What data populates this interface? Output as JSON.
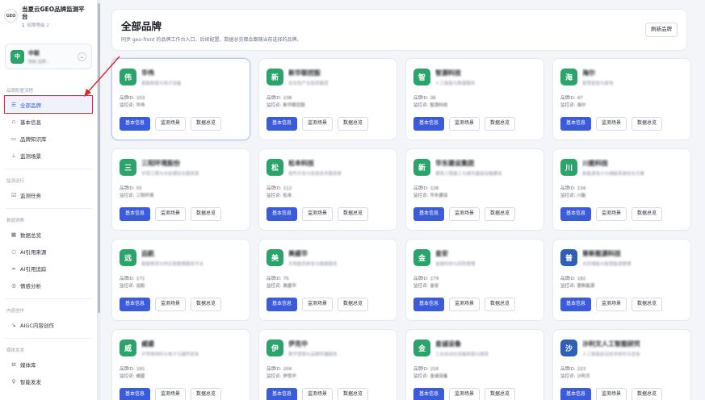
{
  "app": {
    "logo_text": "GEO",
    "title": "当夏云GEO品牌监测平台",
    "sub_num": "1",
    "sub_text": "权限等级 2"
  },
  "current_brand": {
    "logo_char": "中",
    "name": "中联",
    "desc": "智能 品牌..."
  },
  "sidebar": {
    "sections": [
      {
        "title": "品牌配置流程",
        "items": [
          {
            "icon": "☰",
            "label": "全部品牌"
          },
          {
            "icon": "▫",
            "label": "基本信息"
          },
          {
            "icon": "▭",
            "label": "品牌知识库"
          },
          {
            "icon": "⊥",
            "label": "监测场景"
          }
        ]
      },
      {
        "title": "监测运行",
        "items": [
          {
            "icon": "☑",
            "label": "监测任务"
          }
        ]
      },
      {
        "title": "数据洞察",
        "items": [
          {
            "icon": "▦",
            "label": "数据总览"
          },
          {
            "icon": "○",
            "label": "AI引用来源"
          },
          {
            "icon": "∞",
            "label": "AI引用追踪"
          },
          {
            "icon": "◎",
            "label": "情感分析"
          }
        ]
      },
      {
        "title": "内容创作",
        "items": [
          {
            "icon": "↘",
            "label": "AIGC内容创作"
          }
        ]
      },
      {
        "title": "媒体发发",
        "items": [
          {
            "icon": "⊟",
            "label": "媒体库"
          },
          {
            "icon": "♀",
            "label": "智能发发"
          }
        ]
      }
    ]
  },
  "header": {
    "title": "全部品牌",
    "desc": "同步 geo-front 的品牌工作台入口，后续配置、数据总览都会跟随当前选择的品牌。",
    "refresh_label": "刷新品牌"
  },
  "labels": {
    "brand_id": "品牌ID:",
    "keyword": "监控词:",
    "btn_basic": "基本信息",
    "btn_scene": "监测场景",
    "btn_overview": "数据总览"
  },
  "colors": {
    "primary": "#3b5bdb",
    "highlight_red": "#e0262d",
    "brand_green": "#2aa46a"
  },
  "brands": [
    {
      "logo": "伟",
      "color": "#2aa46a",
      "name": "华伟",
      "desc": "智能制造与电子设备",
      "id": "153",
      "kw": "华伟"
    },
    {
      "logo": "新",
      "color": "#2aa46a",
      "name": "新华联控股",
      "desc": "综合性产业投资集团",
      "id": "238",
      "kw": "新华联控股"
    },
    {
      "logo": "智",
      "color": "#2aa46a",
      "name": "智源科技",
      "desc": "人工智能与数据服务",
      "id": "36",
      "kw": "智源科技"
    },
    {
      "logo": "海",
      "color": "#2aa46a",
      "name": "海尔",
      "desc": "智慧家庭与家电",
      "id": "47",
      "kw": "海尔"
    },
    {
      "logo": "三",
      "color": "#2aa46a",
      "name": "三阳环境股份",
      "desc": "环保工程与水处理综合服务商",
      "id": "55",
      "kw": "三阳环境"
    },
    {
      "logo": "松",
      "color": "#2aa46a",
      "name": "松本科技",
      "desc": "软件开发与信息技术服务商",
      "id": "112",
      "kw": "松本"
    },
    {
      "logo": "新",
      "color": "#2aa46a",
      "name": "华东建设集团",
      "desc": "建筑工程施工与城市基础设施建设",
      "id": "126",
      "kw": "华东建设"
    },
    {
      "logo": "川",
      "color": "#2aa46a",
      "name": "川能科技",
      "desc": "新能源电力与储能系统综合方案",
      "id": "134",
      "kw": "川能"
    },
    {
      "logo": "远",
      "color": "#2aa46a",
      "name": "远航",
      "desc": "智能物流与供应链管理服务平台",
      "id": "171",
      "kw": "远航"
    },
    {
      "logo": "美",
      "color": "#2aa46a",
      "name": "美盛华",
      "desc": "生物医药研发与健康服务",
      "id": "75",
      "kw": "美盛华"
    },
    {
      "logo": "金",
      "color": "#2aa46a",
      "name": "金安",
      "desc": "金融科技与风险管理",
      "id": "179",
      "kw": "金安"
    },
    {
      "logo": "普",
      "color": "#2f5fb7",
      "name": "普新能源科技",
      "desc": "光伏储能与智慧能源管理",
      "id": "182",
      "kw": "普新能源"
    },
    {
      "logo": "威",
      "color": "#2aa46a",
      "name": "威盛",
      "desc": "半导体材料与电子元器件研发",
      "id": "191",
      "kw": "威盛"
    },
    {
      "logo": "伊",
      "color": "#2aa46a",
      "name": "伊克中",
      "desc": "数字营销与品牌传播服务",
      "id": "204",
      "kw": "伊克中"
    },
    {
      "logo": "金",
      "color": "#2aa46a",
      "name": "金诚设备",
      "desc": "工业自动化设备制造与维保",
      "id": "216",
      "kw": "金诚设备"
    },
    {
      "logo": "沙",
      "color": "#2f5fb7",
      "name": "沙利文人工智能研究",
      "desc": "人工智能前沿技术研究与咨询",
      "id": "223",
      "kw": "沙利文"
    }
  ]
}
